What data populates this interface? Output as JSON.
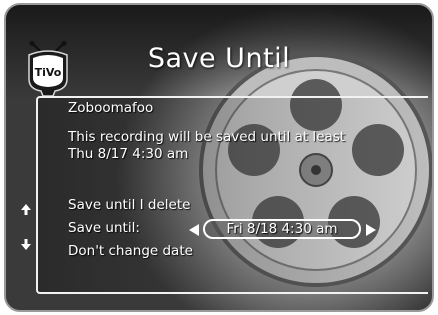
{
  "header": {
    "title": "Save Until",
    "logo_text": "TiVo"
  },
  "recording": {
    "name": "Zoboomafoo",
    "saved_until_line1": "This recording will be saved until at least",
    "saved_until_line2": "Thu 8/17 4:30 am"
  },
  "menu": {
    "items": [
      {
        "label": "Save until I delete"
      },
      {
        "label": "Save until:",
        "value": "Fri 8/18 4:30 am"
      },
      {
        "label": "Don't change date"
      }
    ]
  },
  "icons": {
    "logo": "tivo-logo-icon",
    "up": "up-arrow-icon",
    "down": "down-arrow-icon",
    "left": "left-arrow-icon",
    "right": "right-arrow-icon"
  }
}
